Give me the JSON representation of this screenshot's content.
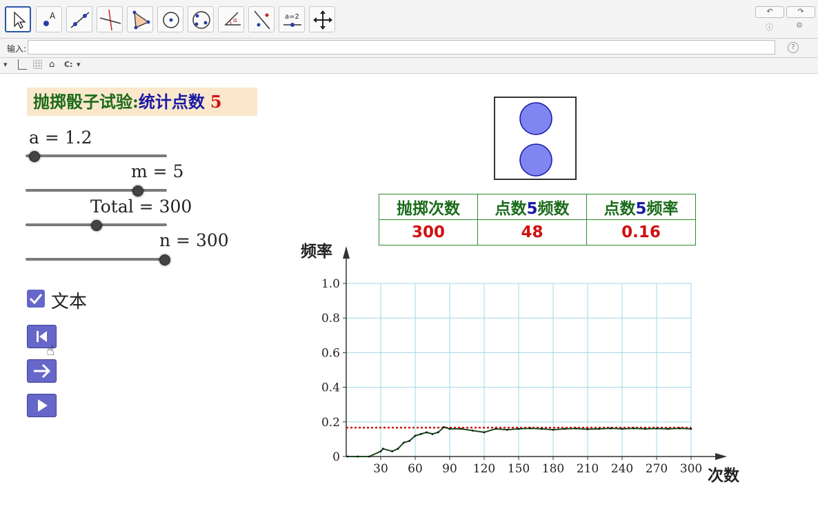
{
  "toolbar": {
    "tools": [
      {
        "name": "move-tool-icon"
      },
      {
        "name": "point-tool-icon"
      },
      {
        "name": "line-tool-icon"
      },
      {
        "name": "perpendicular-tool-icon"
      },
      {
        "name": "polygon-tool-icon"
      },
      {
        "name": "circle-tool-icon"
      },
      {
        "name": "conic-tool-icon"
      },
      {
        "name": "angle-tool-icon"
      },
      {
        "name": "reflect-tool-icon"
      },
      {
        "name": "slider-tool-icon"
      },
      {
        "name": "move-view-tool-icon"
      }
    ],
    "slider_tool_text": "a=2",
    "undo_icon": "undo-icon",
    "redo_icon": "redo-icon"
  },
  "input_bar": {
    "label": "输入:",
    "value": "",
    "help": "?"
  },
  "style_bar": {
    "cmd_label": "C:"
  },
  "title": {
    "part1": "抛掷骰子试验:",
    "part2": "统计点数",
    "part3": "5"
  },
  "sliders": [
    {
      "label": "a = 1.2",
      "fraction": 0.05
    },
    {
      "label": "m = 5",
      "fraction": 0.8
    },
    {
      "label": "Total = 300",
      "fraction": 0.5
    },
    {
      "label": "n = 300",
      "fraction": 1.0
    }
  ],
  "checkbox": {
    "label": "文本",
    "checked": true
  },
  "die": {
    "face": 2
  },
  "table": {
    "headers": [
      {
        "pre": "抛掷次数",
        "mid": "",
        "post": ""
      },
      {
        "pre": "点数",
        "mid": "5",
        "post": "频数"
      },
      {
        "pre": "点数",
        "mid": "5",
        "post": "频率"
      }
    ],
    "values": [
      "300",
      "48",
      "0.16"
    ]
  },
  "colors": {
    "accent": "#6667c9",
    "red": "#d01010",
    "green": "#1a6b1a",
    "blue": "#1a1aa6",
    "grid": "#9fd8ea"
  },
  "chart_data": {
    "type": "line",
    "ylabel": "频率",
    "xlabel": "次数",
    "xlim": [
      0,
      300
    ],
    "ylim": [
      0,
      1.0
    ],
    "xticks": [
      30,
      60,
      90,
      120,
      150,
      180,
      210,
      240,
      270,
      300
    ],
    "yticks": [
      "0",
      "0.2",
      "0.4",
      "0.6",
      "0.8",
      "1.0"
    ],
    "reference_line": 0.1667,
    "x": [
      1,
      10,
      20,
      30,
      32,
      40,
      45,
      50,
      55,
      60,
      65,
      70,
      75,
      80,
      85,
      90,
      100,
      110,
      120,
      130,
      140,
      150,
      160,
      170,
      180,
      190,
      200,
      210,
      220,
      230,
      240,
      250,
      260,
      270,
      280,
      290,
      300
    ],
    "values": [
      0,
      0,
      0,
      0.03,
      0.045,
      0.03,
      0.045,
      0.08,
      0.09,
      0.12,
      0.13,
      0.14,
      0.13,
      0.14,
      0.17,
      0.16,
      0.16,
      0.15,
      0.14,
      0.16,
      0.155,
      0.16,
      0.163,
      0.16,
      0.155,
      0.16,
      0.162,
      0.158,
      0.16,
      0.163,
      0.16,
      0.163,
      0.16,
      0.162,
      0.16,
      0.163,
      0.16
    ]
  }
}
